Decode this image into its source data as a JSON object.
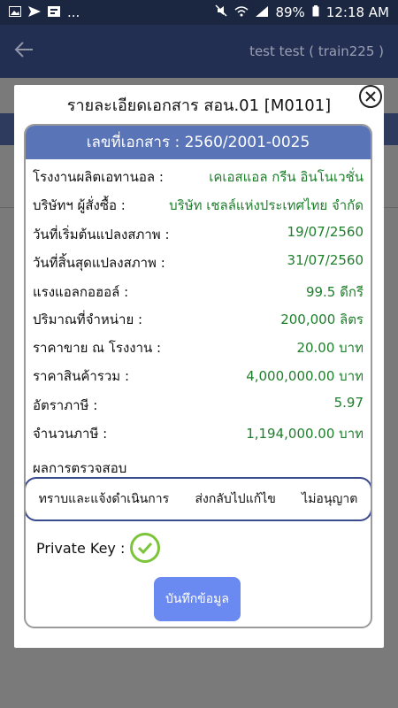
{
  "status": {
    "notif": "...",
    "battery": "89%",
    "time": "12:18 AM"
  },
  "appbar": {
    "title": "test test ( train225 )"
  },
  "modal": {
    "title": "รายละเอียดเอกสาร สอน.01 [M0101]",
    "doc_header": "เลขที่เอกสาร : 2560/2001-0025",
    "rows": [
      {
        "label": "โรงงานผลิตเอทานอล :",
        "value": "เคเอสแอล กรีน อินโนเวชั่น"
      },
      {
        "label": "บริษัทฯ ผู้สั่งซื้อ :",
        "value": "บริษัท เชลล์แห่งประเทศไทย จำกัด"
      },
      {
        "label": "วันที่เริ่มต้นแปลงสภาพ :",
        "value": "19/07/2560"
      },
      {
        "label": "วันที่สิ้นสุดแปลงสภาพ :",
        "value": "31/07/2560"
      },
      {
        "label": "แรงแอลกอฮอล์ :",
        "value": "99.5 ดีกรี"
      },
      {
        "label": "ปริมาณที่จำหน่าย :",
        "value": "200,000 ลิตร"
      },
      {
        "label": "ราคาขาย ณ โรงงาน :",
        "value": "20.00 บาท"
      },
      {
        "label": "ราคาสินค้ารวม :",
        "value": "4,000,000.00 บาท"
      },
      {
        "label": "อัตราภาษี :",
        "value": "5.97"
      },
      {
        "label": "จำนวนภาษี :",
        "value": "1,194,000.00 บาท"
      }
    ],
    "result_label": "ผลการตรวจสอบ",
    "options": [
      "ทราบและแจ้งดำเนินการ",
      "ส่งกลับไปแก้ไข",
      "ไม่อนุญาต"
    ],
    "private_key_label": "Private Key :",
    "save_label": "บันทึกข้อมูล"
  },
  "colors": {
    "header": "#5a74b8",
    "value_text": "#1e7f2b",
    "save_button": "#6a8af2",
    "check": "#7cc43a"
  }
}
